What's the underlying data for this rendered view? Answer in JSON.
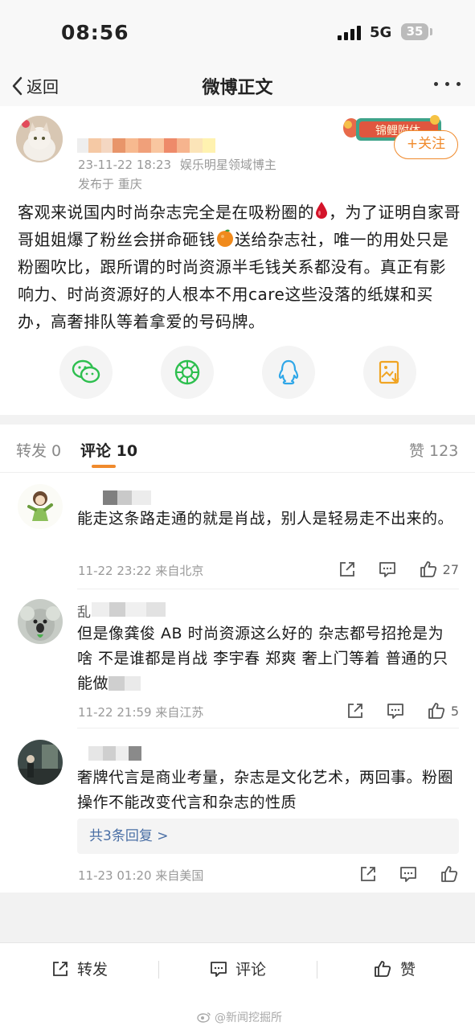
{
  "status_bar": {
    "time": "08:56",
    "network": "5G",
    "battery": "35"
  },
  "nav": {
    "back_label": "返回",
    "title": "微博正文"
  },
  "post": {
    "timestamp": "23-11-22 18:23",
    "author_tag": "娱乐明星领域博主",
    "location": "发布于 重庆",
    "banner_text": "锦鲤附体",
    "follow_label": "+关注",
    "body_1": "客观来说国内时尚杂志完全是在吸粉圈的",
    "body_2": "，为了证明自家哥哥姐姐爆了粉丝会拼命砸钱",
    "body_3": "送给杂志社，唯一的用处只是粉圈吹比，跟所谓的时尚资源半毛钱关系都没有。真正有影响力、时尚资源好的人根本不用care这些没落的纸媒和买办，高奢排队等着拿爱的号码牌。"
  },
  "share": {
    "items": [
      {
        "icon": "wechat-icon"
      },
      {
        "icon": "moments-icon"
      },
      {
        "icon": "qq-icon"
      },
      {
        "icon": "save-image-icon"
      }
    ]
  },
  "tabs": {
    "repost": "转发 0",
    "comments": "评论 10",
    "likes": "赞 123"
  },
  "comments": [
    {
      "text": "能走这条路走通的就是肖战，别人是轻易走不出来的。",
      "meta": "11-22 23:22  来自北京",
      "likes": "27"
    },
    {
      "name_prefix": "乱",
      "text": "但是像龚俊 AB 时尚资源这么好的   杂志都号招抢是为啥     不是谁都是肖战    李宇春  郑爽     奢上门等着   普通的只能做",
      "meta": "11-22 21:59  来自江苏",
      "likes": "5"
    },
    {
      "text": "奢牌代言是商业考量，杂志是文化艺术，两回事。粉圈操作不能改变代言和杂志的性质",
      "reply_label": "共3条回复 >",
      "meta": "11-23 01:20  来自美国",
      "likes": ""
    }
  ],
  "bottom_bar": {
    "repost": "转发",
    "comment": "评论",
    "like": "赞"
  },
  "watermark": "@新闻挖掘所",
  "colors": {
    "accent": "#f08a2c",
    "link": "#4a6fa5",
    "gray_bg": "#f2f2f2"
  }
}
